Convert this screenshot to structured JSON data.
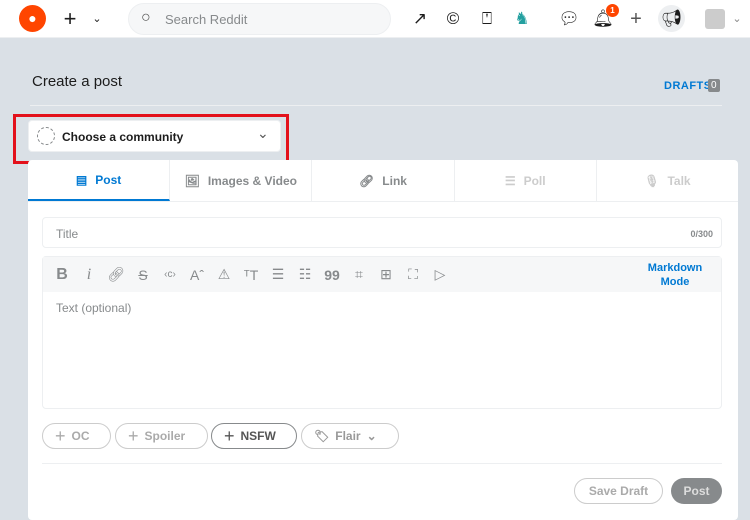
{
  "header": {
    "search_placeholder": "Search Reddit",
    "notification_count": "1"
  },
  "page": {
    "title": "Create a post",
    "drafts_label": "DRAFTS",
    "drafts_count": "0"
  },
  "community": {
    "placeholder": "Choose a community"
  },
  "tabs": [
    {
      "label": "Post"
    },
    {
      "label": "Images & Video"
    },
    {
      "label": "Link"
    },
    {
      "label": "Poll"
    },
    {
      "label": "Talk"
    }
  ],
  "title_field": {
    "placeholder": "Title",
    "counter": "0/300"
  },
  "editor": {
    "markdown_label": "Markdown Mode",
    "placeholder": "Text (optional)"
  },
  "tags": {
    "oc": "OC",
    "spoiler": "Spoiler",
    "nsfw": "NSFW",
    "flair": "Flair"
  },
  "actions": {
    "save_draft": "Save Draft",
    "post": "Post"
  }
}
